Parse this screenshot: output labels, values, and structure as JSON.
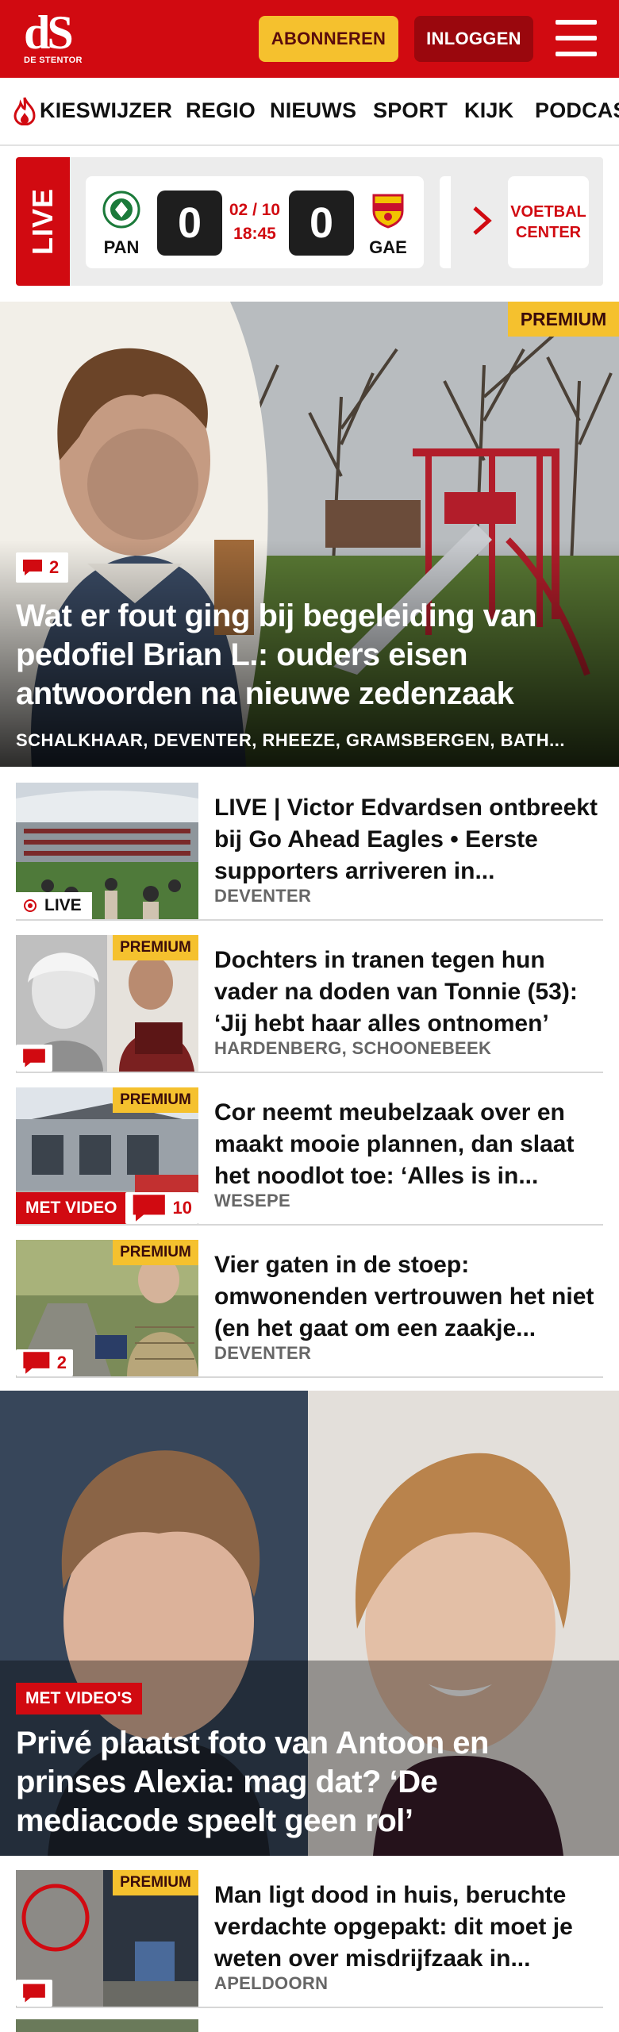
{
  "header": {
    "logo": "dS",
    "logo_sub": "DE STENTOR",
    "subscribe_label": "ABONNEREN",
    "login_label": "INLOGGEN"
  },
  "nav": {
    "items": [
      "KIESWIJZER",
      "REGIO",
      "NIEUWS",
      "SPORT",
      "KIJK",
      "PODCAS"
    ]
  },
  "live": {
    "tag": "LIVE",
    "home_code": "PAN",
    "away_code": "GAE",
    "home_score": "0",
    "away_score": "0",
    "date": "02 / 10",
    "time": "18:45",
    "voetbal_center": "VOETBAL CENTER"
  },
  "hero": {
    "premium": "PREMIUM",
    "comments": "2",
    "title": "Wat er fout ging bij begeleiding van pedofiel Brian L.: ouders eisen antwoorden na nieuwe zedenzaak",
    "location": "SCHALKHAAR, DEVENTER, RHEEZE, GRAMSBERGEN, BATH..."
  },
  "articles": [
    {
      "title": "LIVE | Victor Edvardsen ontbreekt bij Go Ahead Eagles • Eerste supporters arriveren in...",
      "location": "DEVENTER",
      "live_label": "LIVE"
    },
    {
      "title": "Dochters in tranen tegen hun vader na doden van Tonnie (53): ‘Jij hebt haar alles ontnomen’",
      "location": "HARDENBERG, SCHOONEBEEK",
      "premium": "PREMIUM"
    },
    {
      "title": "Cor neemt meubelzaak over en maakt mooie plannen, dan slaat het noodlot toe: ‘Alles is in...",
      "location": "WESEPE",
      "premium": "PREMIUM",
      "video": "MET VIDEO",
      "comments": "10"
    },
    {
      "title": "Vier gaten in de stoep: omwonenden vertrouwen het niet (en het gaat om een zaakje...",
      "location": "DEVENTER",
      "premium": "PREMIUM",
      "comments": "2"
    }
  ],
  "hero2": {
    "video": "MET VIDEO'S",
    "title": "Privé plaatst foto van Antoon en prinses Alexia: mag dat? ‘De mediacode speelt geen rol’"
  },
  "article5": {
    "title": "Man ligt dood in huis, beruchte verdachte opgepakt: dit moet je weten over misdrijfzaak in...",
    "location": "APELDOORN",
    "premium": "PREMIUM"
  },
  "colors": {
    "brand_red": "#d10a11",
    "premium_yellow": "#f5c12e"
  }
}
